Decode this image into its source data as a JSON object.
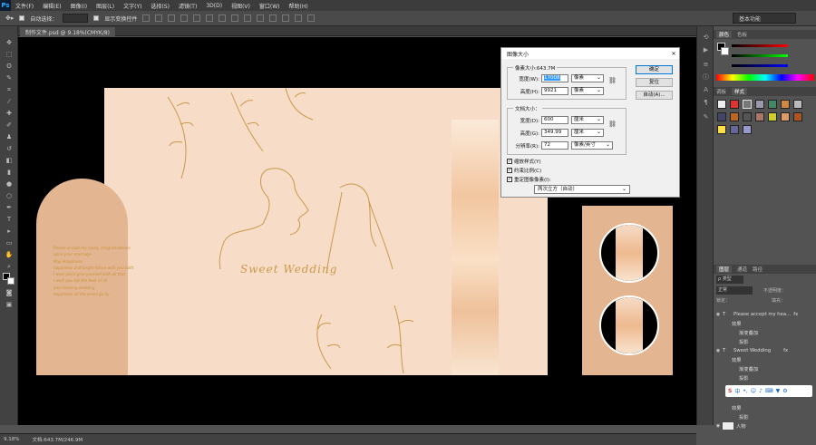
{
  "menu": {
    "logo": "Ps",
    "items": [
      "文件(F)",
      "编辑(E)",
      "图像(I)",
      "图层(L)",
      "文字(Y)",
      "选择(S)",
      "滤镜(T)",
      "3D(D)",
      "视图(V)",
      "窗口(W)",
      "帮助(H)"
    ]
  },
  "options": {
    "auto_select_label": "自动选择：",
    "auto_select_value": "",
    "transform_label": "显示变换控件",
    "workspace": "基本功能"
  },
  "doc_tab": "制作文件.psd @ 9.18%(CMYK/8)",
  "artwork": {
    "title": "Sweet  Wedding",
    "poem": [
      "Please accept my lovely congratulations",
      "upon your marriage",
      "May Happiness",
      "happiness and bright future with you both",
      "I wish you'll give yourself with all that",
      "I wish you tak the best of all",
      "and blessing,wedding",
      "happiness all the years go by"
    ]
  },
  "dialog": {
    "title": "图像大小",
    "pixel_dims": "像素大小:643.7M",
    "width_label": "宽度(W):",
    "width_value": "17008",
    "width_unit": "像素",
    "height_label": "高度(H):",
    "height_value": "9921",
    "height_unit": "像素",
    "doc_size": "文档大小：",
    "dw_label": "宽度(D):",
    "dw_value": "600",
    "dw_unit": "厘米",
    "dh_label": "高度(G):",
    "dh_value": "349.99",
    "dh_unit": "厘米",
    "res_label": "分辨率(R):",
    "res_value": "72",
    "res_unit": "像素/英寸",
    "scale_styles": "缩放样式(Y)",
    "constrain": "约束比例(C)",
    "resample": "重定图像像素(I):",
    "resample_method": "两次立方（自动）",
    "ok": "确定",
    "reset": "复位",
    "auto": "自动(A)..."
  },
  "panels": {
    "color_tabs": [
      "颜色",
      "色板"
    ],
    "style_tabs": [
      "调板",
      "样式"
    ],
    "layer_tabs": [
      "图层",
      "通道",
      "路径"
    ],
    "kind": "ρ 类型",
    "mode": "正常",
    "opacity": "不透明度：",
    "lock": "锁定：",
    "fill": "填充："
  },
  "layers": [
    {
      "name": "Please accept my hea...",
      "type": "T",
      "fx": "fx"
    },
    {
      "name": "效果",
      "type": ""
    },
    {
      "name": "渐变叠加",
      "type": ""
    },
    {
      "name": "投影",
      "type": ""
    },
    {
      "name": "Sweet  Wedding",
      "type": "T",
      "fx": "fx"
    },
    {
      "name": "效果",
      "type": ""
    },
    {
      "name": "渐变叠加",
      "type": ""
    },
    {
      "name": "投影",
      "type": ""
    },
    {
      "name": "效果",
      "type": ""
    },
    {
      "name": "投影",
      "type": ""
    },
    {
      "name": "人物",
      "type": ""
    }
  ],
  "status": {
    "zoom": "9.18%",
    "doc": "文档:643.7M/246.9M"
  },
  "ime": {
    "icon": "S",
    "label": "中"
  },
  "colors": {
    "canvas": "#000000",
    "art": "#f7dcc8",
    "tan": "#e3b591",
    "gold": "#c99a4a"
  }
}
